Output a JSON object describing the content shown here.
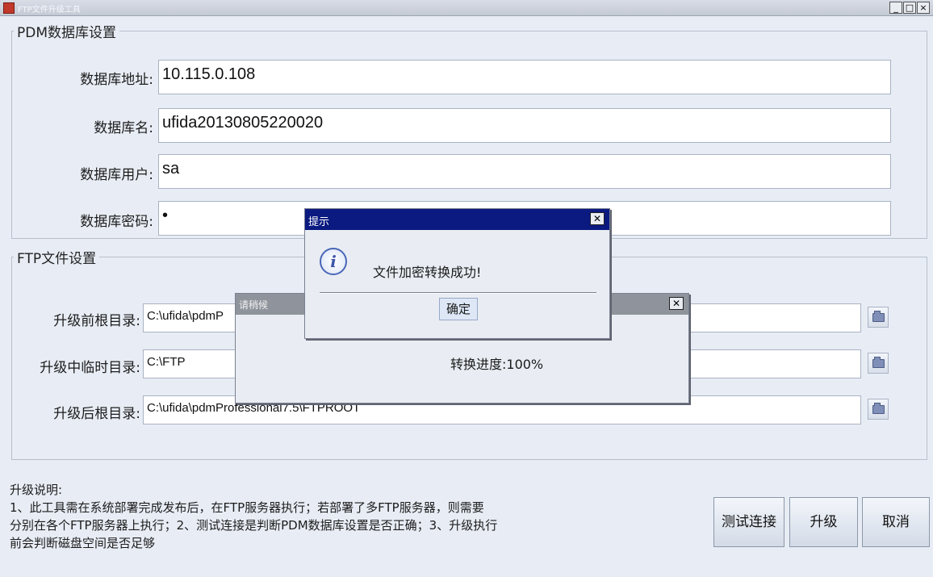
{
  "window": {
    "title": "FTP文件升级工具",
    "controls": {
      "minimize": "_",
      "maximize": "□",
      "close": "×"
    }
  },
  "pdm_group": {
    "title": "PDM数据库设置",
    "fields": [
      {
        "label": "数据库地址:",
        "value": "10.115.0.108"
      },
      {
        "label": "数据库名:",
        "value": "ufida20130805220020"
      },
      {
        "label": "数据库用户:",
        "value": "sa"
      },
      {
        "label": "数据库密码:",
        "value": "•"
      }
    ]
  },
  "ftp_group": {
    "title": "FTP文件设置",
    "fields": [
      {
        "label": "升级前根目录:",
        "value": "C:\\ufida\\pdmP"
      },
      {
        "label": "升级中临时目录:",
        "value": "C:\\FTP"
      },
      {
        "label": "升级后根目录:",
        "value": "C:\\ufida\\pdmProfessional7.5\\FTPROOT"
      }
    ]
  },
  "description": {
    "title": "升级说明:",
    "line1": "1、此工具需在系统部署完成发布后，在FTP服务器执行；若部署了多FTP服务器，则需要",
    "line2": "分别在各个FTP服务器上执行；2、测试连接是判断PDM数据库设置是否正确；3、升级执行",
    "line3": "前会判断磁盘空间是否足够"
  },
  "buttons": {
    "test": "测试连接",
    "upgrade": "升级",
    "cancel": "取消"
  },
  "progress_dialog": {
    "title": "请稍候",
    "progress_text": "转换进度:100%",
    "progress": 1.0
  },
  "alert_dialog": {
    "title": "提示",
    "message": "文件加密转换成功!",
    "ok": "确定",
    "icon": "info-icon"
  },
  "colors": {
    "alert_titlebar": "#0a1a80",
    "progress_titlebar": "#8f949c",
    "window_bg": "#e8edf5"
  }
}
